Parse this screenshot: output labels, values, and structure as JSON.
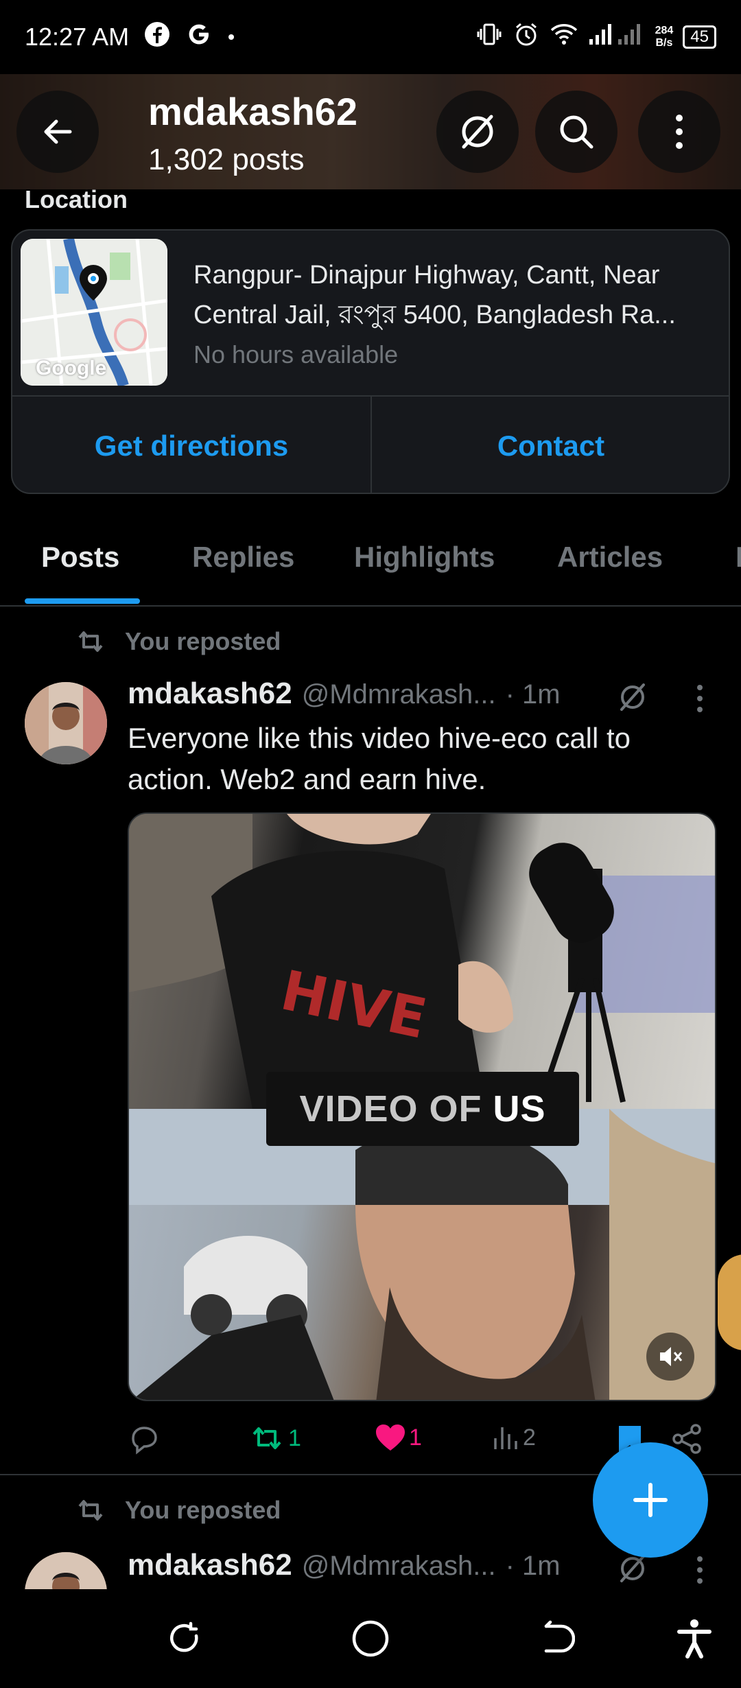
{
  "status_bar": {
    "time": "12:27 AM",
    "net_speed_value": "284",
    "net_speed_unit": "B/s",
    "battery": "45"
  },
  "header": {
    "title": "mdakash62",
    "subtitle": "1,302 posts"
  },
  "location": {
    "label": "Location",
    "address": "Rangpur- Dinajpur Highway, Cantt, Near Central Jail, রংপুর 5400, Bangladesh Ra...",
    "hours": "No hours available",
    "map_brand": "Google",
    "directions_label": "Get directions",
    "contact_label": "Contact"
  },
  "tabs": [
    {
      "label": "Posts",
      "active": true
    },
    {
      "label": "Replies",
      "active": false
    },
    {
      "label": "Highlights",
      "active": false
    },
    {
      "label": "Articles",
      "active": false
    },
    {
      "label": "M",
      "active": false
    }
  ],
  "posts": [
    {
      "repost_label": "You reposted",
      "name": "mdakash62",
      "handle": "@Mdmrakash...",
      "time": "· 1m",
      "text": "Everyone like this video hive-eco  call to action. Web2 and earn hive.",
      "video_label_light": "VIDEO OF",
      "video_label_bold": "US",
      "retweets": "1",
      "likes": "1",
      "views": "2"
    },
    {
      "repost_label": "You reposted",
      "name": "mdakash62",
      "handle": "@Mdmrakash...",
      "time": "· 1m"
    }
  ],
  "colors": {
    "accent": "#1d9bf0",
    "retweet_green": "#00ba7c",
    "like_pink": "#f91880",
    "muted_text": "#71767b",
    "background": "#000000"
  }
}
